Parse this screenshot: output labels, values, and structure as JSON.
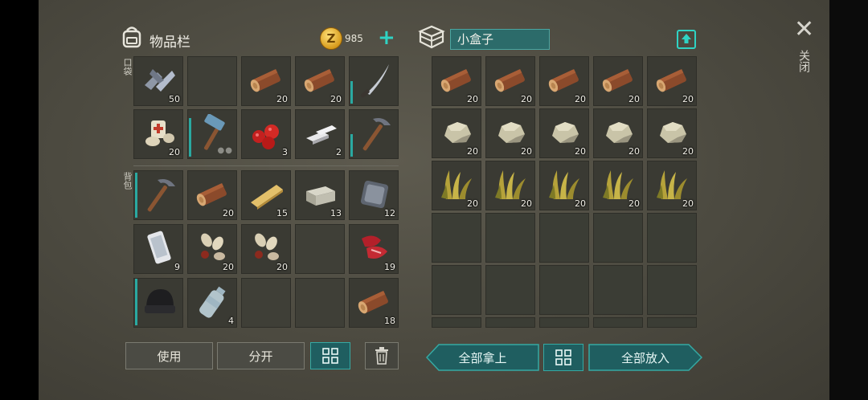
{
  "inventory": {
    "title": "物品栏",
    "coin_symbol": "Z",
    "coins": "985",
    "add_symbol": "+",
    "pocket_label": "口袋",
    "backpack_label": "背包",
    "pocket_slots": [
      {
        "icon": "scrap-metal-icon",
        "count": "50"
      },
      {
        "icon": "",
        "count": ""
      },
      {
        "icon": "log-icon",
        "count": "20"
      },
      {
        "icon": "log-icon",
        "count": "20"
      },
      {
        "icon": "machete-icon",
        "count": ""
      },
      {
        "icon": "bandage-icon",
        "count": "20"
      },
      {
        "icon": "hammer-icon",
        "count": ""
      },
      {
        "icon": "berries-icon",
        "count": "3"
      },
      {
        "icon": "iron-bar-icon",
        "count": "2"
      },
      {
        "icon": "pickaxe-icon",
        "count": ""
      }
    ],
    "backpack_slots": [
      {
        "icon": "pickaxe-icon",
        "count": ""
      },
      {
        "icon": "log-icon",
        "count": "20"
      },
      {
        "icon": "plank-icon",
        "count": "15"
      },
      {
        "icon": "stone-block-icon",
        "count": "13"
      },
      {
        "icon": "metal-plate-icon",
        "count": "12"
      },
      {
        "icon": "phone-icon",
        "count": "9"
      },
      {
        "icon": "seeds-icon",
        "count": "20"
      },
      {
        "icon": "seeds-icon",
        "count": "20"
      },
      {
        "icon": "",
        "count": ""
      },
      {
        "icon": "raw-meat-icon",
        "count": "19"
      },
      {
        "icon": "beanie-hat-icon",
        "count": ""
      },
      {
        "icon": "water-bottle-icon",
        "count": "4"
      },
      {
        "icon": "",
        "count": ""
      },
      {
        "icon": "",
        "count": ""
      },
      {
        "icon": "log-icon",
        "count": "18"
      }
    ],
    "buttons": {
      "use": "使用",
      "split": "分开"
    }
  },
  "container": {
    "name": "小盒子",
    "slots": [
      {
        "icon": "log-icon",
        "count": "20"
      },
      {
        "icon": "log-icon",
        "count": "20"
      },
      {
        "icon": "log-icon",
        "count": "20"
      },
      {
        "icon": "log-icon",
        "count": "20"
      },
      {
        "icon": "log-icon",
        "count": "20"
      },
      {
        "icon": "stone-icon",
        "count": "20"
      },
      {
        "icon": "stone-icon",
        "count": "20"
      },
      {
        "icon": "stone-icon",
        "count": "20"
      },
      {
        "icon": "stone-icon",
        "count": "20"
      },
      {
        "icon": "stone-icon",
        "count": "20"
      },
      {
        "icon": "plant-fiber-icon",
        "count": "20"
      },
      {
        "icon": "plant-fiber-icon",
        "count": "20"
      },
      {
        "icon": "plant-fiber-icon",
        "count": "20"
      },
      {
        "icon": "plant-fiber-icon",
        "count": "20"
      },
      {
        "icon": "plant-fiber-icon",
        "count": "20"
      }
    ],
    "buttons": {
      "take_all": "全部拿上",
      "put_all": "全部放入"
    }
  },
  "close": {
    "symbol": "✕",
    "label": "关闭"
  },
  "colors": {
    "accent": "#2fd3c4",
    "panel": "#4c4a40",
    "slot": "#3a3a33"
  }
}
